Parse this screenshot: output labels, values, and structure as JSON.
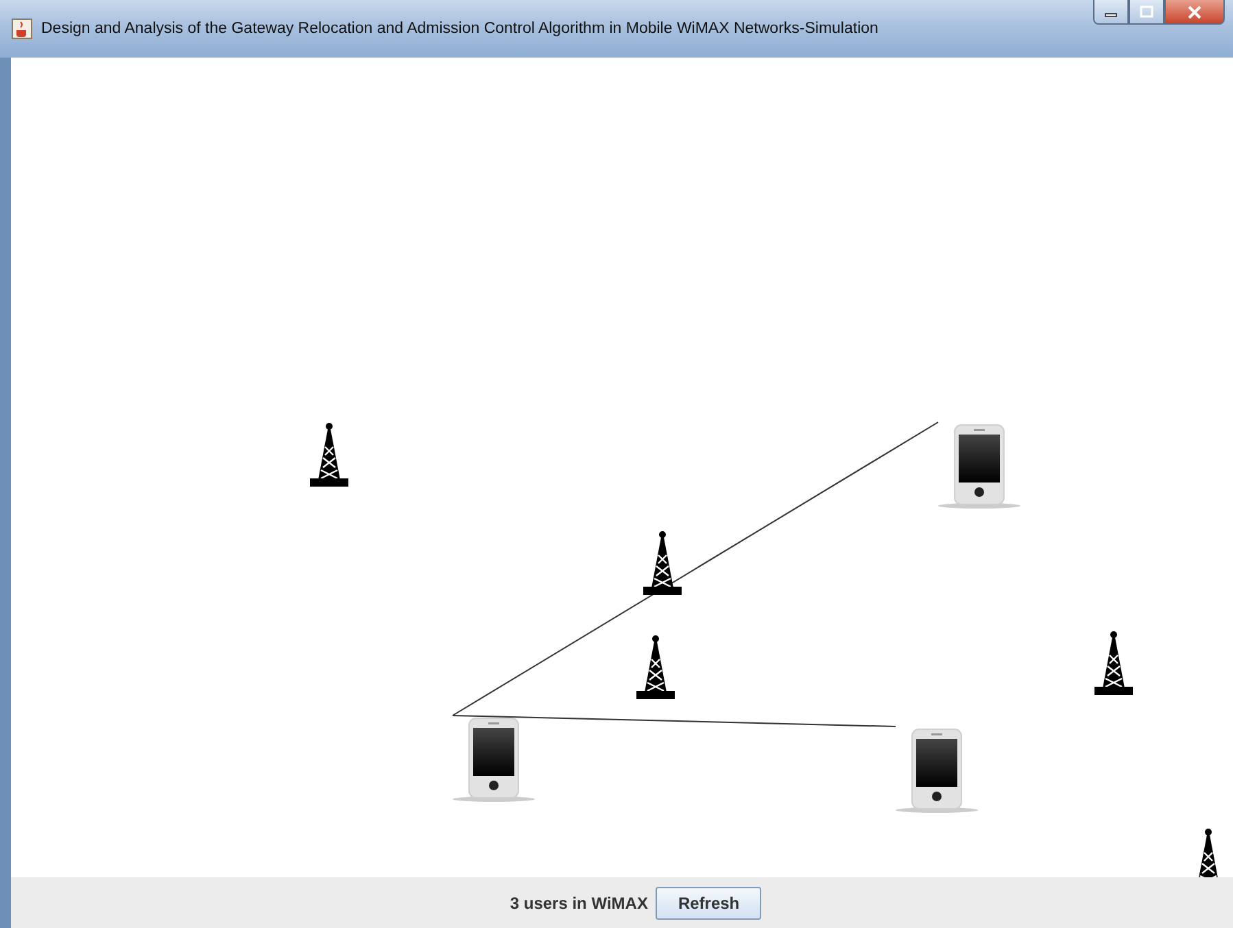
{
  "window": {
    "title": "Design and Analysis of the Gateway Relocation and Admission Control Algorithm in Mobile WiMAX Networks-Simulation"
  },
  "nodes": [
    {
      "kind": "tower"
    },
    {
      "kind": "tower"
    },
    {
      "kind": "tower"
    },
    {
      "kind": "tower"
    },
    {
      "kind": "tower"
    },
    {
      "kind": "phone"
    },
    {
      "kind": "phone"
    },
    {
      "kind": "phone"
    }
  ],
  "status": {
    "text": "3 users in WiMAX",
    "button": "Refresh"
  }
}
